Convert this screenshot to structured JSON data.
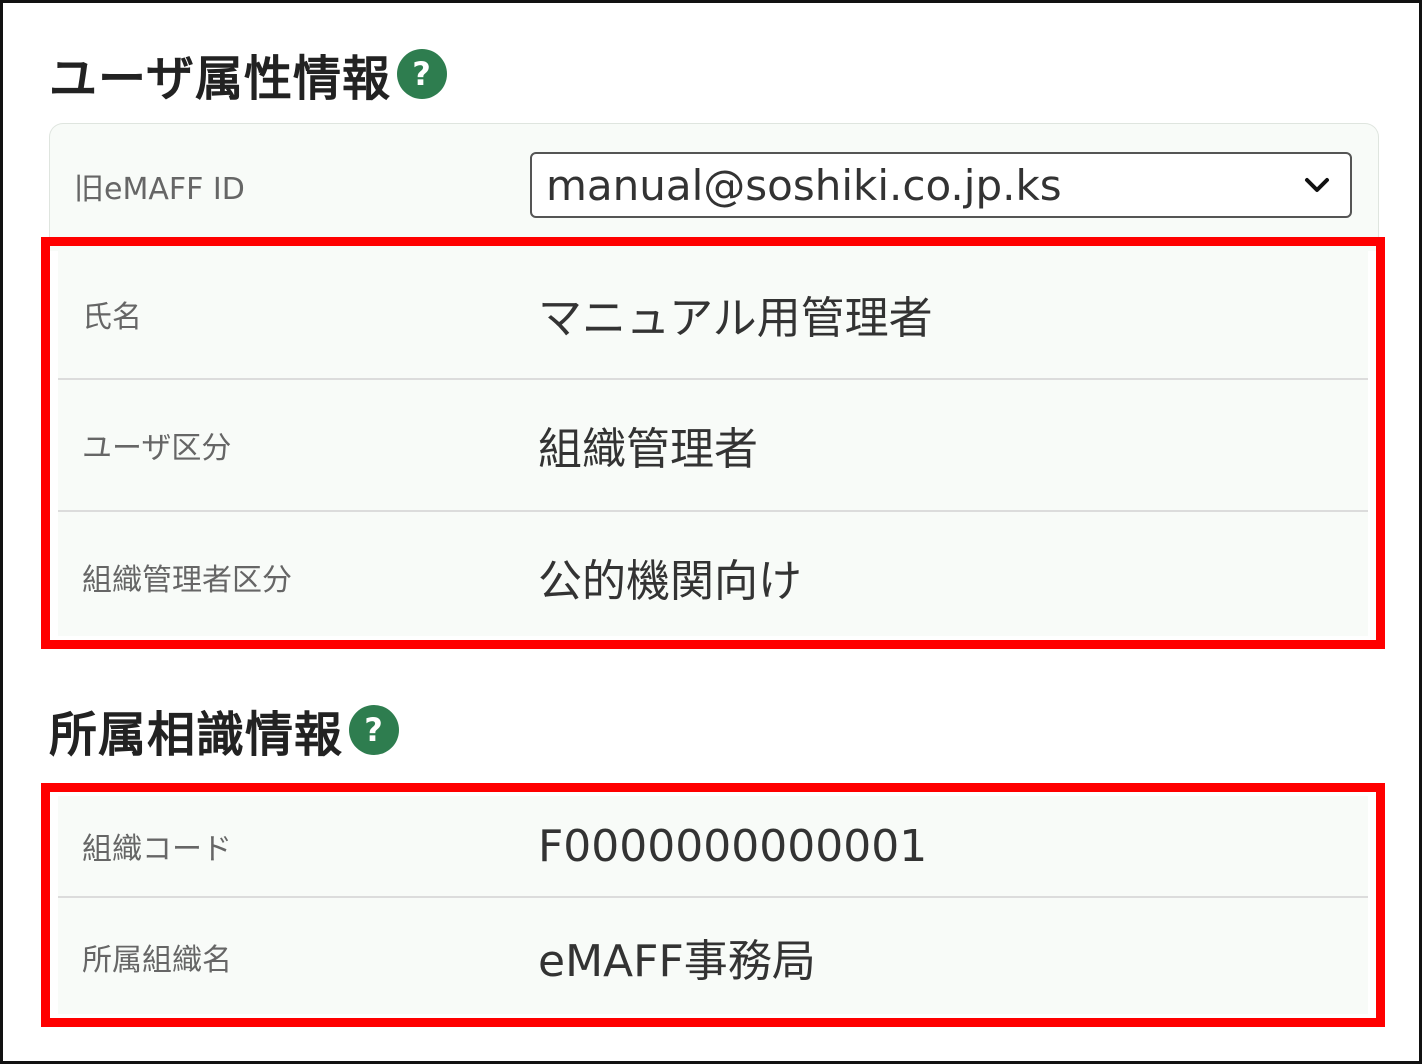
{
  "user_attributes": {
    "heading": "ユーザ属性情報",
    "help_icon_glyph": "?",
    "old_emaff_id": {
      "label": "旧eMAFF ID",
      "selected_value": "manual@soshiki.co.jp.ks"
    },
    "rows": [
      {
        "label": "氏名",
        "value": "マニュアル用管理者"
      },
      {
        "label": "ユーザ区分",
        "value": "組織管理者"
      },
      {
        "label": "組織管理者区分",
        "value": "公的機関向け"
      }
    ]
  },
  "organization": {
    "heading": "所属相識情報",
    "help_icon_glyph": "?",
    "rows": [
      {
        "label": "組織コード",
        "value": "F0000000000001"
      },
      {
        "label": "所属組織名",
        "value": "eMAFF事務局"
      }
    ]
  },
  "colors": {
    "accent_green": "#2e7d4f",
    "highlight_red": "#ff0000"
  },
  "icons": {
    "help": "question-circle-icon",
    "dropdown": "chevron-down-icon"
  }
}
